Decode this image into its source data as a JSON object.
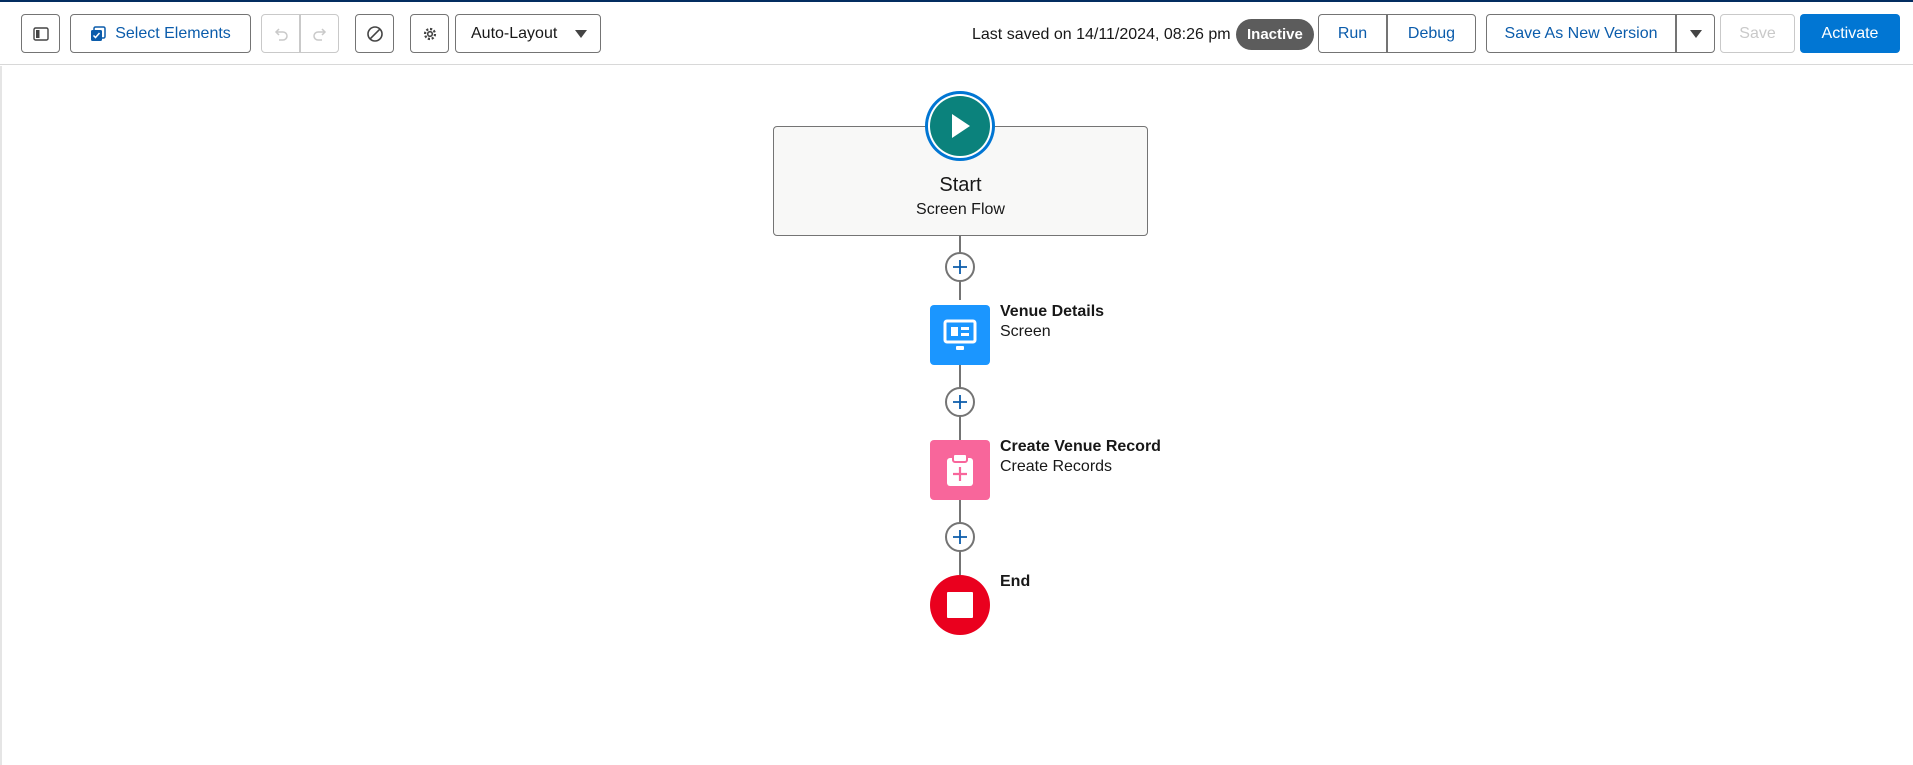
{
  "toolbar": {
    "select_elements_label": "Select Elements",
    "layout_select_value": "Auto-Layout",
    "last_saved_text": "Last saved on 14/11/2024, 08:26 pm",
    "status_badge": "Inactive",
    "run_label": "Run",
    "debug_label": "Debug",
    "save_as_new_version_label": "Save As New Version",
    "save_label": "Save",
    "activate_label": "Activate"
  },
  "flow": {
    "start": {
      "title": "Start",
      "subtitle": "Screen Flow",
      "icon": "play-icon"
    },
    "elements": [
      {
        "title": "Venue Details",
        "subtitle": "Screen",
        "icon": "screen-icon",
        "color": "#1b96ff"
      },
      {
        "title": "Create Venue Record",
        "subtitle": "Create Records",
        "icon": "clipboard-add-icon",
        "color": "#f8669b"
      }
    ],
    "end": {
      "title": "End",
      "icon": "stop-icon",
      "color": "#ea001e"
    }
  },
  "colors": {
    "brand": "#0176d3",
    "link": "#0b5cab",
    "start_teal": "#0b827c",
    "badge_gray": "#5c5c5c"
  }
}
